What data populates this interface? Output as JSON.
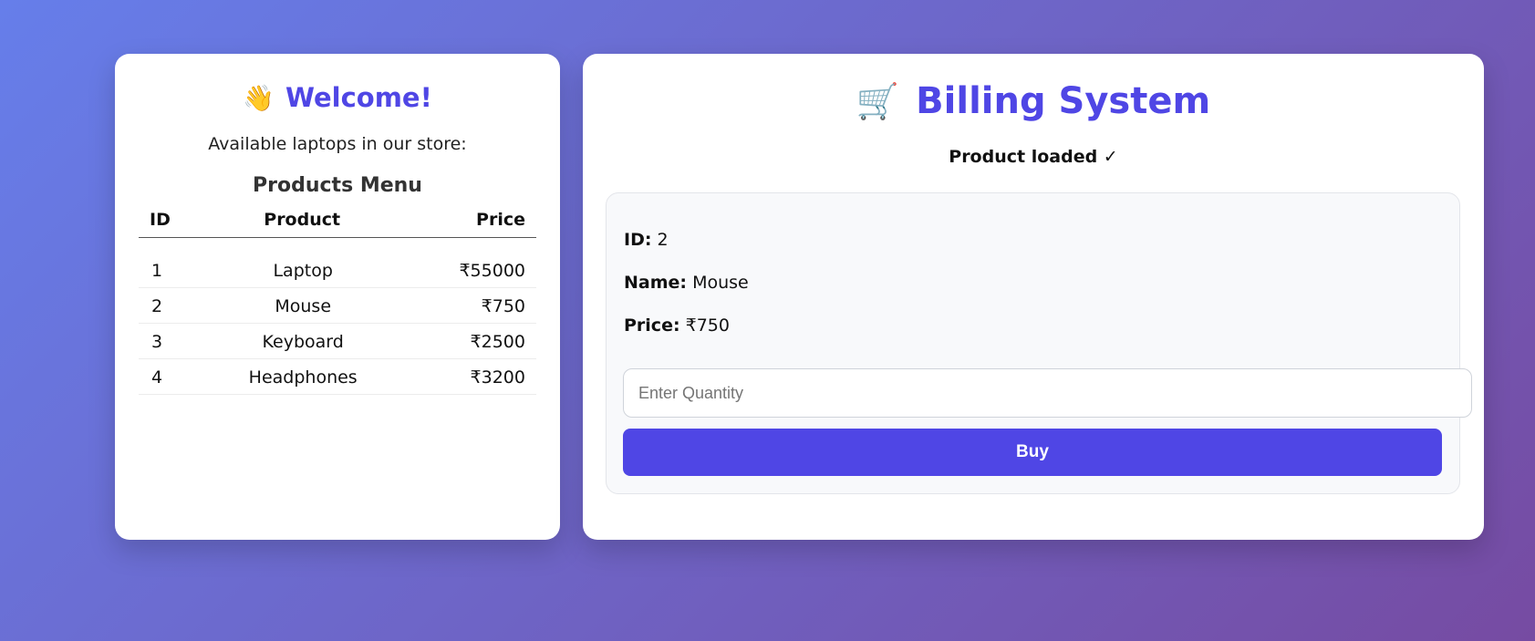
{
  "welcome": {
    "icon": "waving-hand-icon",
    "icon_glyph": "👋",
    "title": "Welcome!",
    "subtitle": "Available laptops in our store:",
    "menu_title": "Products Menu",
    "columns": {
      "id": "ID",
      "product": "Product",
      "price": "Price"
    },
    "products": [
      {
        "id": "1",
        "name": "Laptop",
        "price": "₹55000"
      },
      {
        "id": "2",
        "name": "Mouse",
        "price": "₹750"
      },
      {
        "id": "3",
        "name": "Keyboard",
        "price": "₹2500"
      },
      {
        "id": "4",
        "name": "Headphones",
        "price": "₹3200"
      }
    ]
  },
  "billing": {
    "icon": "shopping-cart-icon",
    "icon_glyph": "🛒",
    "title": "Billing System",
    "status": "Product loaded ✓",
    "selected": {
      "id_label": "ID:",
      "id_value": "2",
      "name_label": "Name:",
      "name_value": "Mouse",
      "price_label": "Price:",
      "price_value": "₹750"
    },
    "quantity_placeholder": "Enter Quantity",
    "quantity_value": "",
    "buy_label": "Buy"
  },
  "colors": {
    "accent": "#4f46e5",
    "gradient_start": "#667eea",
    "gradient_end": "#764ba2"
  }
}
